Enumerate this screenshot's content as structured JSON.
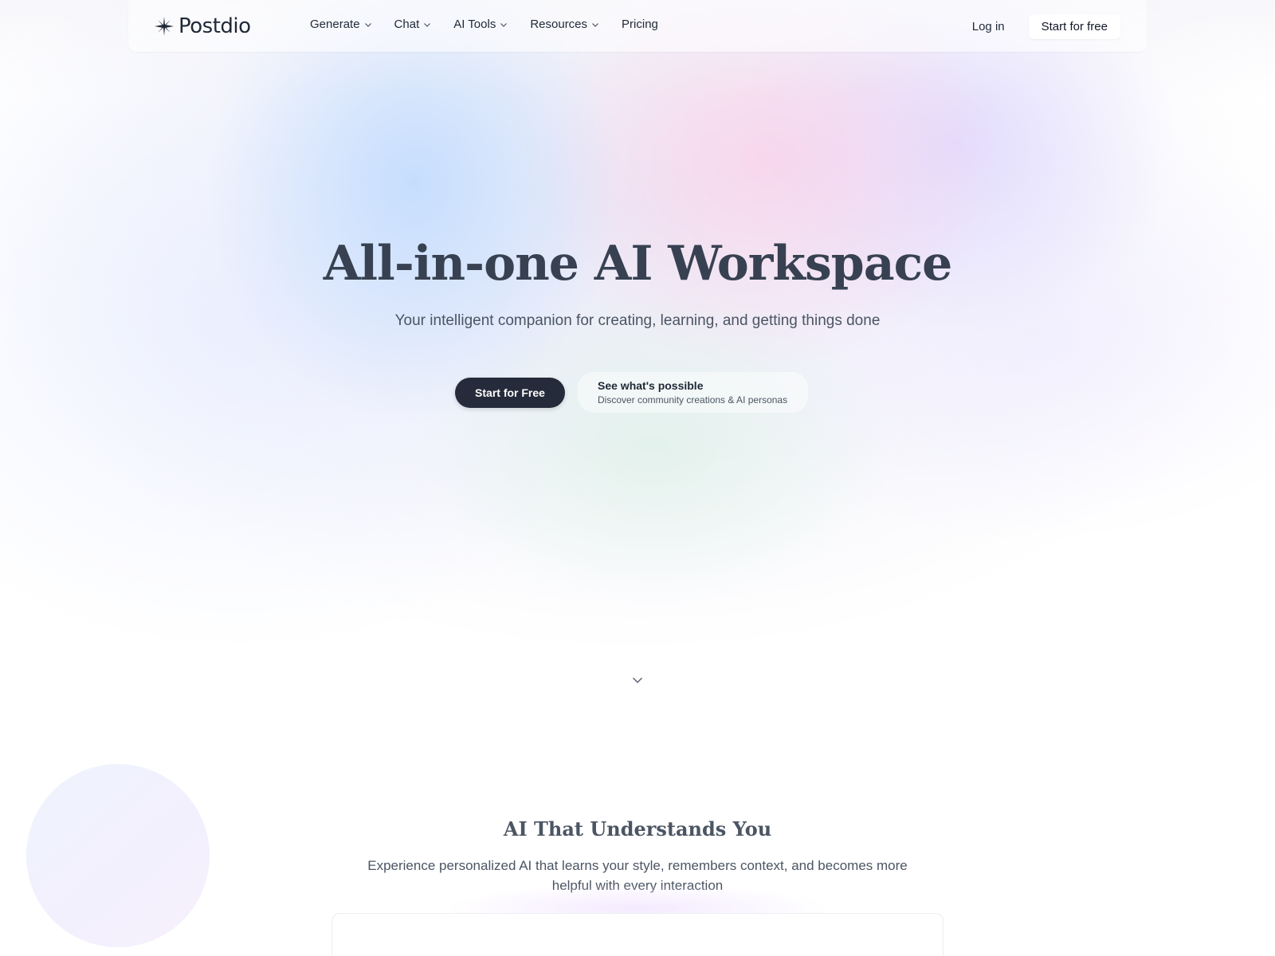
{
  "brand": {
    "name": "Postdio",
    "logo_icon": "sparkle-star-icon"
  },
  "nav": {
    "items": [
      {
        "label": "Generate",
        "has_dropdown": true
      },
      {
        "label": "Chat",
        "has_dropdown": true
      },
      {
        "label": "AI Tools",
        "has_dropdown": true
      },
      {
        "label": "Resources",
        "has_dropdown": true
      },
      {
        "label": "Pricing",
        "has_dropdown": false
      }
    ],
    "login_label": "Log in",
    "cta_label": "Start for free"
  },
  "hero": {
    "title": "All-in-one AI Workspace",
    "subtitle": "Your intelligent companion for creating, learning, and getting things done",
    "primary_cta": "Start for Free",
    "secondary_title": "See what's possible",
    "secondary_desc": "Discover community creations & AI personas",
    "scroll_icon": "chevron-down-icon"
  },
  "section": {
    "title": "AI That Understands You",
    "description": "Experience personalized AI that learns your style, remembers context, and becomes more helpful with every interaction"
  },
  "colors": {
    "primary_button": "#252b3a",
    "heading": "#374151",
    "body_text": "#4b5563"
  }
}
